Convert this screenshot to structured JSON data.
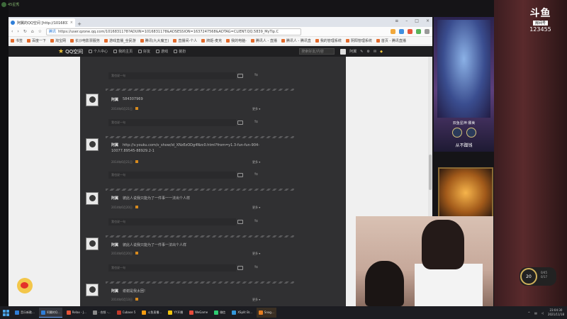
{
  "overlay": {
    "logo": "斗鱼",
    "room_label": "房间号",
    "room_number": "123455",
    "top_left": "45星秀"
  },
  "browser": {
    "tab_title": "阿翼的QQ空间 [http://10168311",
    "url_site": "腾讯",
    "url": "https://user.qzone.qq.com/1016831178?ADUIN=1016831178&ADSESSION=1637247568&ADTAG=CLIENT.QQ.5839_MyTip.C",
    "bookmarks": [
      "书签",
      "百度一下",
      "淘宝网",
      "长沙电影票服务",
      "游戏直播_全民游",
      "腾讯(九大魔王)",
      "直播间-个人",
      "牌姬-麦克",
      "我的电脑-",
      "腾讯人 - 直播",
      "腾讯人 - 腾讯直",
      "我的管理系统",
      "阴阳管理系统",
      "首页 - 腾讯直播"
    ]
  },
  "qzone": {
    "logo": "QQ空间",
    "nav": [
      "个人中心",
      "我的主页",
      "好友",
      "游戏",
      "装扮"
    ],
    "search_placeholder": "搜索好友/内容",
    "user": "阿翼",
    "reply_placeholder": "我也说一句",
    "more": "更多 ▾",
    "posts": [
      {
        "user": "阿翼",
        "text": "584307969",
        "date": "2014年6月21日"
      },
      {
        "user": "阿翼",
        "text": "http://v.youku.com/v_show/id_XNzEzODg4Nzc0.html?from=y1.3-fun-fun-904-10077.89545-88929.2-1",
        "date": "2014年6月21日"
      },
      {
        "user": "阿翼",
        "text": "彼此人说我只能为了一件事一一法出个人样",
        "date": "2014年6月20日"
      },
      {
        "user": "阿翼",
        "text": "彼此人说我只能为了一件事一法出个人样",
        "date": "2014年6月20日"
      },
      {
        "user": "阿翼",
        "text": "谢谢是我太困!",
        "date": "2014年6月13日"
      }
    ]
  },
  "game_card": {
    "name": "双鱼星神 娜美",
    "tag": "从不蹭钱"
  },
  "hud": {
    "level": "20",
    "line1": "0/45",
    "line2": "0/17"
  },
  "taskbar": {
    "items": [
      "音乐新歌...",
      "阿翼的Q...",
      "Relax - J...",
      "· 合频 ·...",
      "Cubase 5",
      "斗鱼直播...",
      "YY开播",
      "WeGame",
      "微信",
      "XSplit Br...",
      "Snag..."
    ],
    "time": "23:04:30",
    "date": "2021/11/18"
  }
}
